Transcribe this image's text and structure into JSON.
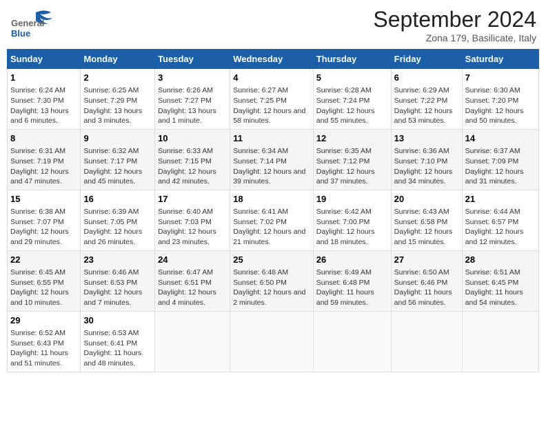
{
  "header": {
    "logo_general": "General",
    "logo_blue": "Blue",
    "month_title": "September 2024",
    "location": "Zona 179, Basilicate, Italy"
  },
  "columns": [
    "Sunday",
    "Monday",
    "Tuesday",
    "Wednesday",
    "Thursday",
    "Friday",
    "Saturday"
  ],
  "weeks": [
    [
      {
        "day": "1",
        "sunrise": "6:24 AM",
        "sunset": "7:30 PM",
        "daylight": "13 hours and 6 minutes."
      },
      {
        "day": "2",
        "sunrise": "6:25 AM",
        "sunset": "7:29 PM",
        "daylight": "13 hours and 3 minutes."
      },
      {
        "day": "3",
        "sunrise": "6:26 AM",
        "sunset": "7:27 PM",
        "daylight": "13 hours and 1 minute."
      },
      {
        "day": "4",
        "sunrise": "6:27 AM",
        "sunset": "7:25 PM",
        "daylight": "12 hours and 58 minutes."
      },
      {
        "day": "5",
        "sunrise": "6:28 AM",
        "sunset": "7:24 PM",
        "daylight": "12 hours and 55 minutes."
      },
      {
        "day": "6",
        "sunrise": "6:29 AM",
        "sunset": "7:22 PM",
        "daylight": "12 hours and 53 minutes."
      },
      {
        "day": "7",
        "sunrise": "6:30 AM",
        "sunset": "7:20 PM",
        "daylight": "12 hours and 50 minutes."
      }
    ],
    [
      {
        "day": "8",
        "sunrise": "6:31 AM",
        "sunset": "7:19 PM",
        "daylight": "12 hours and 47 minutes."
      },
      {
        "day": "9",
        "sunrise": "6:32 AM",
        "sunset": "7:17 PM",
        "daylight": "12 hours and 45 minutes."
      },
      {
        "day": "10",
        "sunrise": "6:33 AM",
        "sunset": "7:15 PM",
        "daylight": "12 hours and 42 minutes."
      },
      {
        "day": "11",
        "sunrise": "6:34 AM",
        "sunset": "7:14 PM",
        "daylight": "12 hours and 39 minutes."
      },
      {
        "day": "12",
        "sunrise": "6:35 AM",
        "sunset": "7:12 PM",
        "daylight": "12 hours and 37 minutes."
      },
      {
        "day": "13",
        "sunrise": "6:36 AM",
        "sunset": "7:10 PM",
        "daylight": "12 hours and 34 minutes."
      },
      {
        "day": "14",
        "sunrise": "6:37 AM",
        "sunset": "7:09 PM",
        "daylight": "12 hours and 31 minutes."
      }
    ],
    [
      {
        "day": "15",
        "sunrise": "6:38 AM",
        "sunset": "7:07 PM",
        "daylight": "12 hours and 29 minutes."
      },
      {
        "day": "16",
        "sunrise": "6:39 AM",
        "sunset": "7:05 PM",
        "daylight": "12 hours and 26 minutes."
      },
      {
        "day": "17",
        "sunrise": "6:40 AM",
        "sunset": "7:03 PM",
        "daylight": "12 hours and 23 minutes."
      },
      {
        "day": "18",
        "sunrise": "6:41 AM",
        "sunset": "7:02 PM",
        "daylight": "12 hours and 21 minutes."
      },
      {
        "day": "19",
        "sunrise": "6:42 AM",
        "sunset": "7:00 PM",
        "daylight": "12 hours and 18 minutes."
      },
      {
        "day": "20",
        "sunrise": "6:43 AM",
        "sunset": "6:58 PM",
        "daylight": "12 hours and 15 minutes."
      },
      {
        "day": "21",
        "sunrise": "6:44 AM",
        "sunset": "6:57 PM",
        "daylight": "12 hours and 12 minutes."
      }
    ],
    [
      {
        "day": "22",
        "sunrise": "6:45 AM",
        "sunset": "6:55 PM",
        "daylight": "12 hours and 10 minutes."
      },
      {
        "day": "23",
        "sunrise": "6:46 AM",
        "sunset": "6:53 PM",
        "daylight": "12 hours and 7 minutes."
      },
      {
        "day": "24",
        "sunrise": "6:47 AM",
        "sunset": "6:51 PM",
        "daylight": "12 hours and 4 minutes."
      },
      {
        "day": "25",
        "sunrise": "6:48 AM",
        "sunset": "6:50 PM",
        "daylight": "12 hours and 2 minutes."
      },
      {
        "day": "26",
        "sunrise": "6:49 AM",
        "sunset": "6:48 PM",
        "daylight": "11 hours and 59 minutes."
      },
      {
        "day": "27",
        "sunrise": "6:50 AM",
        "sunset": "6:46 PM",
        "daylight": "11 hours and 56 minutes."
      },
      {
        "day": "28",
        "sunrise": "6:51 AM",
        "sunset": "6:45 PM",
        "daylight": "11 hours and 54 minutes."
      }
    ],
    [
      {
        "day": "29",
        "sunrise": "6:52 AM",
        "sunset": "6:43 PM",
        "daylight": "11 hours and 51 minutes."
      },
      {
        "day": "30",
        "sunrise": "6:53 AM",
        "sunset": "6:41 PM",
        "daylight": "11 hours and 48 minutes."
      },
      null,
      null,
      null,
      null,
      null
    ]
  ]
}
